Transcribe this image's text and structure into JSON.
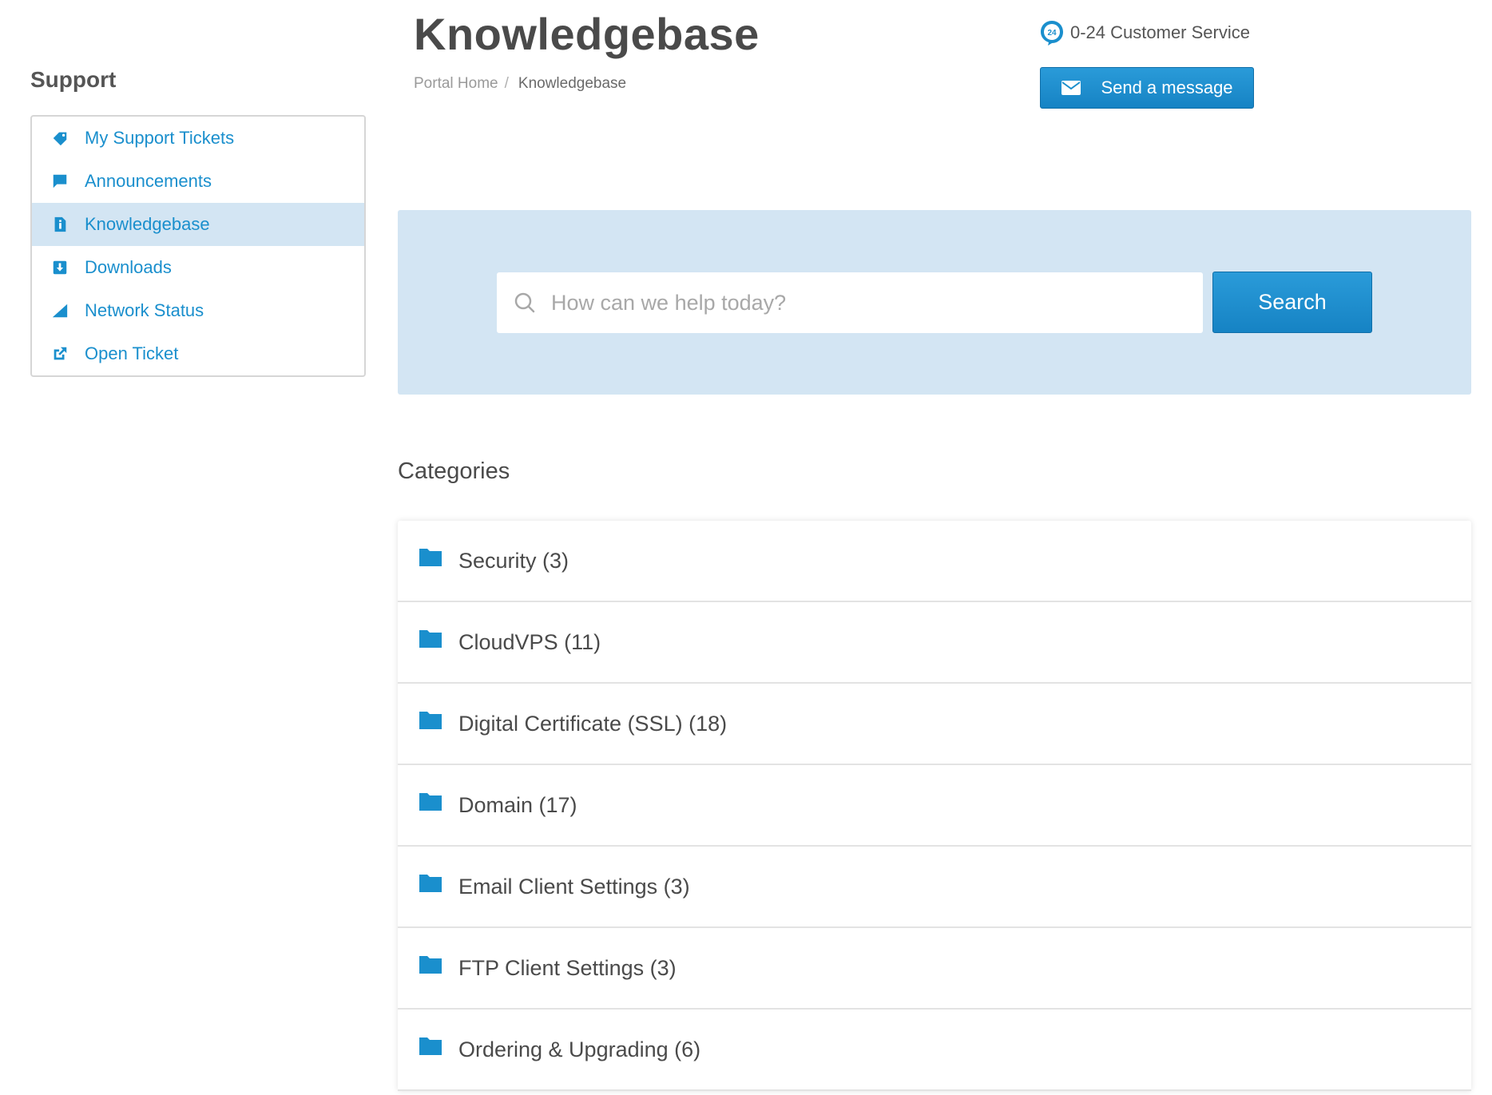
{
  "sidebar": {
    "heading": "Support",
    "items": [
      {
        "label": "My Support Tickets",
        "icon": "ticket-icon"
      },
      {
        "label": "Announcements",
        "icon": "comment-icon"
      },
      {
        "label": "Knowledgebase",
        "icon": "info-file-icon",
        "active": true
      },
      {
        "label": "Downloads",
        "icon": "download-icon"
      },
      {
        "label": "Network Status",
        "icon": "signal-icon"
      },
      {
        "label": "Open Ticket",
        "icon": "external-link-icon"
      }
    ]
  },
  "header": {
    "title": "Knowledgebase",
    "breadcrumb": {
      "home": "Portal Home",
      "separator": "/",
      "current": "Knowledgebase"
    },
    "customer_service": "0-24 Customer Service",
    "customer_service_badge": "24",
    "send_message_label": "Send a message"
  },
  "search": {
    "placeholder": "How can we help today?",
    "value": "",
    "button_label": "Search"
  },
  "categories": {
    "heading": "Categories",
    "items": [
      {
        "label": "Security (3)"
      },
      {
        "label": "CloudVPS (11)"
      },
      {
        "label": "Digital Certificate (SSL) (18)"
      },
      {
        "label": "Domain (17)"
      },
      {
        "label": "Email Client Settings (3)"
      },
      {
        "label": "FTP Client Settings (3)"
      },
      {
        "label": "Ordering & Upgrading (6)"
      }
    ]
  },
  "colors": {
    "accent": "#1a8fcd",
    "hero_background": "#d3e5f3",
    "active_item_background": "#d3e5f3",
    "button_blue": "#1a8fcd",
    "folder_blue": "#1a8fcd"
  }
}
